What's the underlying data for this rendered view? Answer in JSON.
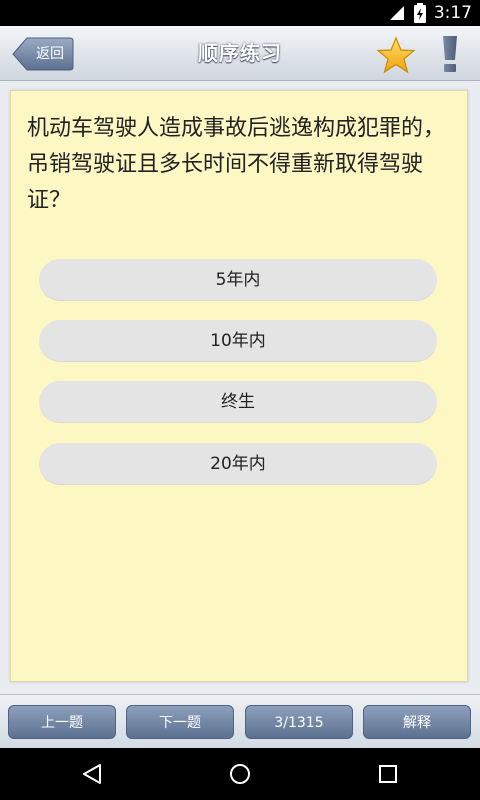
{
  "status_bar": {
    "time": "3:17"
  },
  "header": {
    "back_label": "返回",
    "title": "顺序练习"
  },
  "question": {
    "text": "机动车驾驶人造成事故后逃逸构成犯罪的，吊销驾驶证且多长时间不得重新取得驾驶证？",
    "options": [
      "5年内",
      "10年内",
      "终生",
      "20年内"
    ]
  },
  "toolbar": {
    "prev_label": "上一题",
    "next_label": "下一题",
    "progress": "3/1315",
    "explain_label": "解释"
  },
  "colors": {
    "card_background": "#fdf7c3",
    "option_background": "#e4e4e4",
    "toolbar_button": "#6f83a3",
    "star": "#f6b61a"
  },
  "icons": [
    "wifi-icon",
    "battery-icon",
    "star-icon",
    "alert-icon",
    "nav-back-icon",
    "nav-home-icon",
    "nav-recent-icon"
  ]
}
